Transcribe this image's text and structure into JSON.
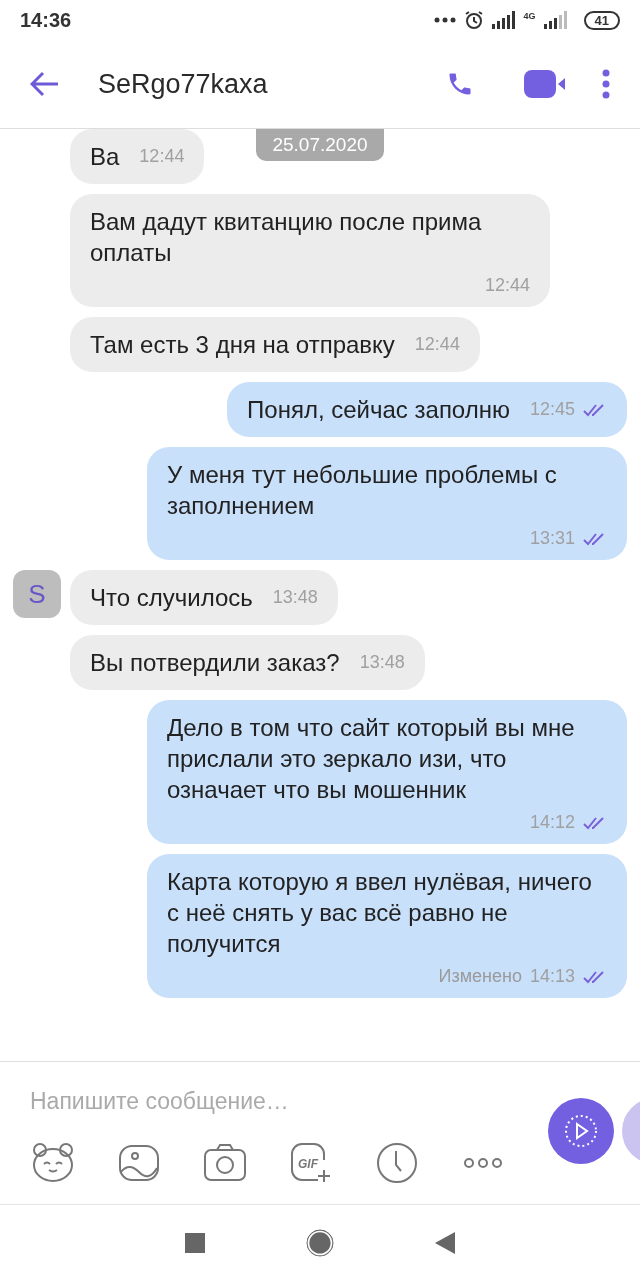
{
  "status_bar": {
    "time": "14:36",
    "network": "4G",
    "battery": "41"
  },
  "header": {
    "title": "SeRgo77kaxa"
  },
  "date_label": "25.07.2020",
  "messages": [
    {
      "kind": "incoming",
      "text": "Ва",
      "time": "12:44"
    },
    {
      "kind": "incoming",
      "text": "Вам дадут квитанцию после прима оплаты",
      "time": "12:44"
    },
    {
      "kind": "incoming",
      "text": "Там есть 3 дня на отправку",
      "time": "12:44"
    },
    {
      "kind": "outgoing",
      "text": "Понял, сейчас заполню",
      "time": "12:45",
      "read": true
    },
    {
      "kind": "outgoing",
      "text": "У меня тут небольшие проблемы с заполнением",
      "time": "13:31",
      "read": true
    },
    {
      "kind": "incoming",
      "text": "Что случилось",
      "time": "13:48",
      "avatar": "S"
    },
    {
      "kind": "incoming",
      "text": "Вы потвердили заказ?",
      "time": "13:48"
    },
    {
      "kind": "outgoing",
      "text": "Дело в том что сайт который вы мне прислали это зеркало изи, что означает что вы мошенник",
      "time": "14:12",
      "read": true
    },
    {
      "kind": "outgoing",
      "text": "Карта которую я ввел нулёвая, ничего с неё снять у вас всё равно не получится",
      "time": "14:13",
      "read": true,
      "edited": "Изменено"
    }
  ],
  "composer": {
    "placeholder": "Напишите сообщение…",
    "gif_label": "GIF"
  }
}
